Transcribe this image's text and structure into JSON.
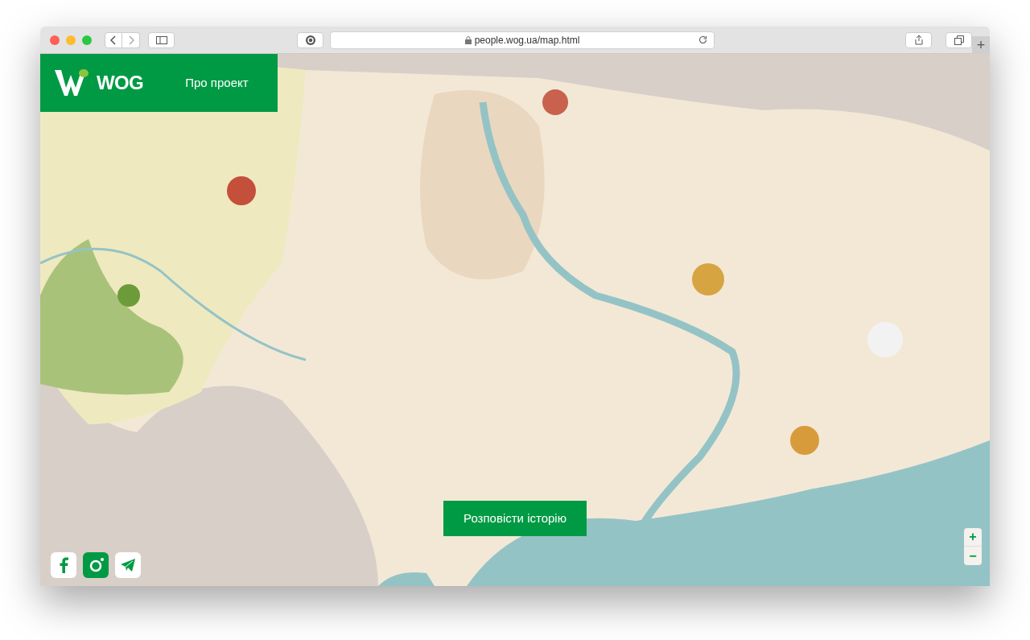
{
  "browser": {
    "url": "people.wog.ua/map.html",
    "new_tab": "+"
  },
  "header": {
    "logo_text": "WOG",
    "nav_link": "Про проект"
  },
  "cta_button": "Розповісти історію",
  "zoom_controls": {
    "zoom_in": "+",
    "zoom_out": "−"
  }
}
